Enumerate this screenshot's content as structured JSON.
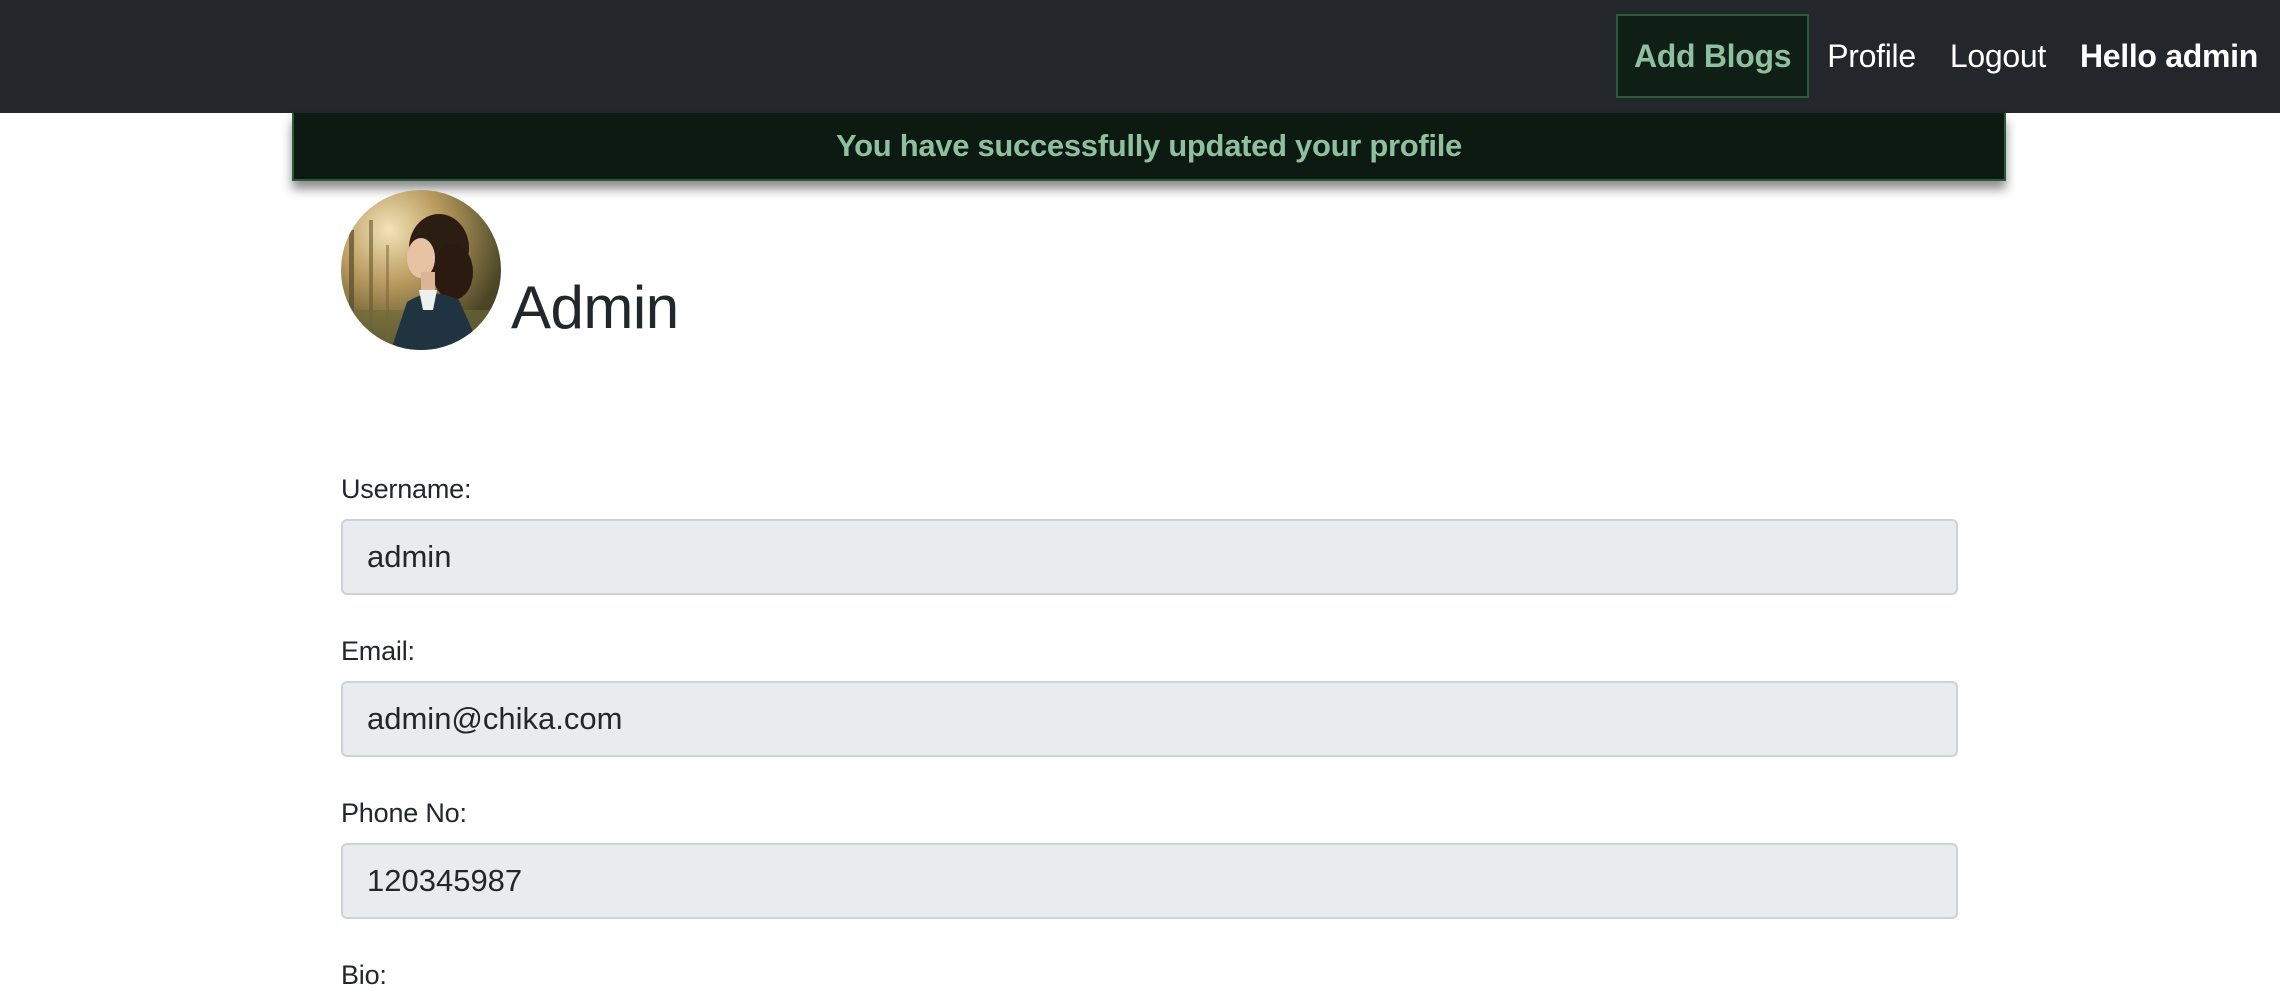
{
  "navbar": {
    "add_blogs": "Add Blogs",
    "profile": "Profile",
    "logout": "Logout",
    "greeting": "Hello admin"
  },
  "alert": {
    "message": "You have successfully updated your profile"
  },
  "profile": {
    "name": "Admin"
  },
  "form": {
    "username_label": "Username:",
    "username_value": "admin",
    "email_label": "Email:",
    "email_value": "admin@chika.com",
    "phone_label": "Phone No:",
    "phone_value": "120345987",
    "bio_label": "Bio:"
  },
  "colors": {
    "navbar_bg": "#23262a",
    "accent_green": "#8ebf9f",
    "alert_bg": "#0c1a12",
    "input_bg": "#e9ebef"
  }
}
